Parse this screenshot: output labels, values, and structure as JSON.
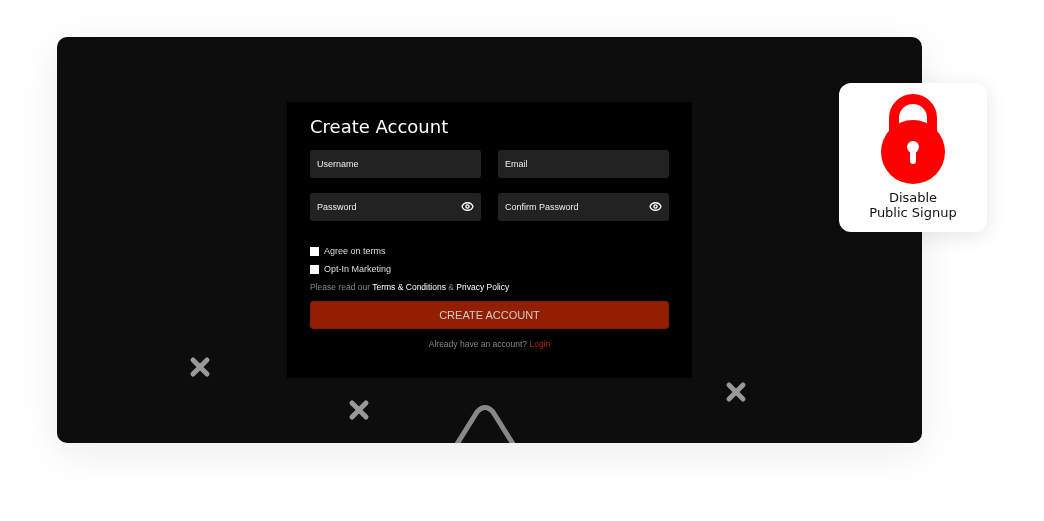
{
  "form": {
    "title": "Create Account",
    "fields": [
      {
        "placeholder": "Username",
        "kind": "text"
      },
      {
        "placeholder": "Email",
        "kind": "text"
      },
      {
        "placeholder": "Password",
        "kind": "password"
      },
      {
        "placeholder": "Confirm Password",
        "kind": "password"
      }
    ],
    "checkboxes": [
      {
        "label": "Agree on terms",
        "checked": false
      },
      {
        "label": "Opt-In Marketing",
        "checked": false
      }
    ],
    "notice": {
      "text": "Please read our",
      "links": [
        "Terms & Conditions",
        "Privacy Policy"
      ],
      "joiner": "&"
    },
    "submit": "CREATE ACCOUNT",
    "footer": {
      "text": "Already have an account?",
      "link": "Login"
    }
  },
  "badge": {
    "lines": [
      "Disable",
      "Public Signup"
    ]
  }
}
